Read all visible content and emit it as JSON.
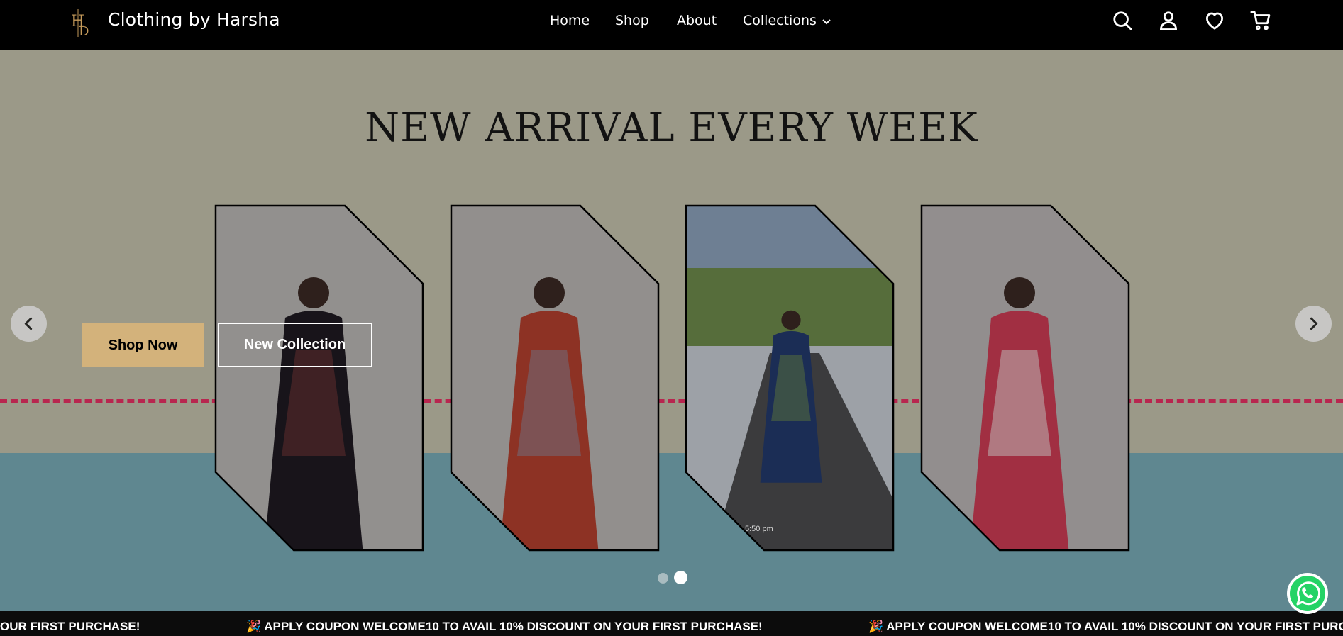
{
  "brand": {
    "name": "Clothing by Harsha",
    "logo_letters": "HD"
  },
  "nav": {
    "items": [
      {
        "label": "Home"
      },
      {
        "label": "Shop"
      },
      {
        "label": "About"
      },
      {
        "label": "Collections",
        "icon": "chevron-down-icon"
      }
    ]
  },
  "header_icons": [
    "search-icon",
    "account-icon",
    "heart-icon",
    "cart-icon"
  ],
  "hero": {
    "title": "NEW ARRIVAL EVERY WEEK",
    "shop_now_label": "Shop Now",
    "new_collection_label": "New Collection",
    "prev_icon": "chevron-left-icon",
    "next_icon": "chevron-right-icon",
    "slides_total": 2,
    "active_slide": 2
  },
  "cards": [
    {
      "name": "black-printed-kurta-photo",
      "outfit": "#1f1a22",
      "accent": "#7a3a3a",
      "wall": "#e6e2de"
    },
    {
      "name": "red-printed-kurta-photo",
      "outfit": "#b5412f",
      "accent": "#8f8a9e",
      "wall": "#e5e1dd"
    },
    {
      "name": "blue-shirt-dress-photo",
      "outfit": "#233a6e",
      "accent": "#6f8c4c",
      "wall": "#c9cfd6"
    },
    {
      "name": "pink-printed-kurta-photo",
      "outfit": "#cf3d55",
      "accent": "#f2e9e9",
      "wall": "#e4e0de"
    }
  ],
  "card_caption": "5:50 pm",
  "ticker": {
    "message_a": "OUR FIRST PURCHASE!",
    "message": "🎉 APPLY COUPON WELCOME10 TO AVAIL 10% DISCOUNT ON YOUR FIRST PURCHASE!",
    "message_c": "🎉 APPLY COUPON WELCOME10 TO AVAIL 10% DISCOUNT ON YOUR FIRST PURCH"
  },
  "colors": {
    "header_bg": "#000000",
    "hero_bg": "#9b9988",
    "teal_bg": "#5f8790",
    "dash": "#b8264f",
    "shop_now": "#d3b27b",
    "whatsapp": "#25d366"
  },
  "whatsapp_icon": "whatsapp-icon"
}
